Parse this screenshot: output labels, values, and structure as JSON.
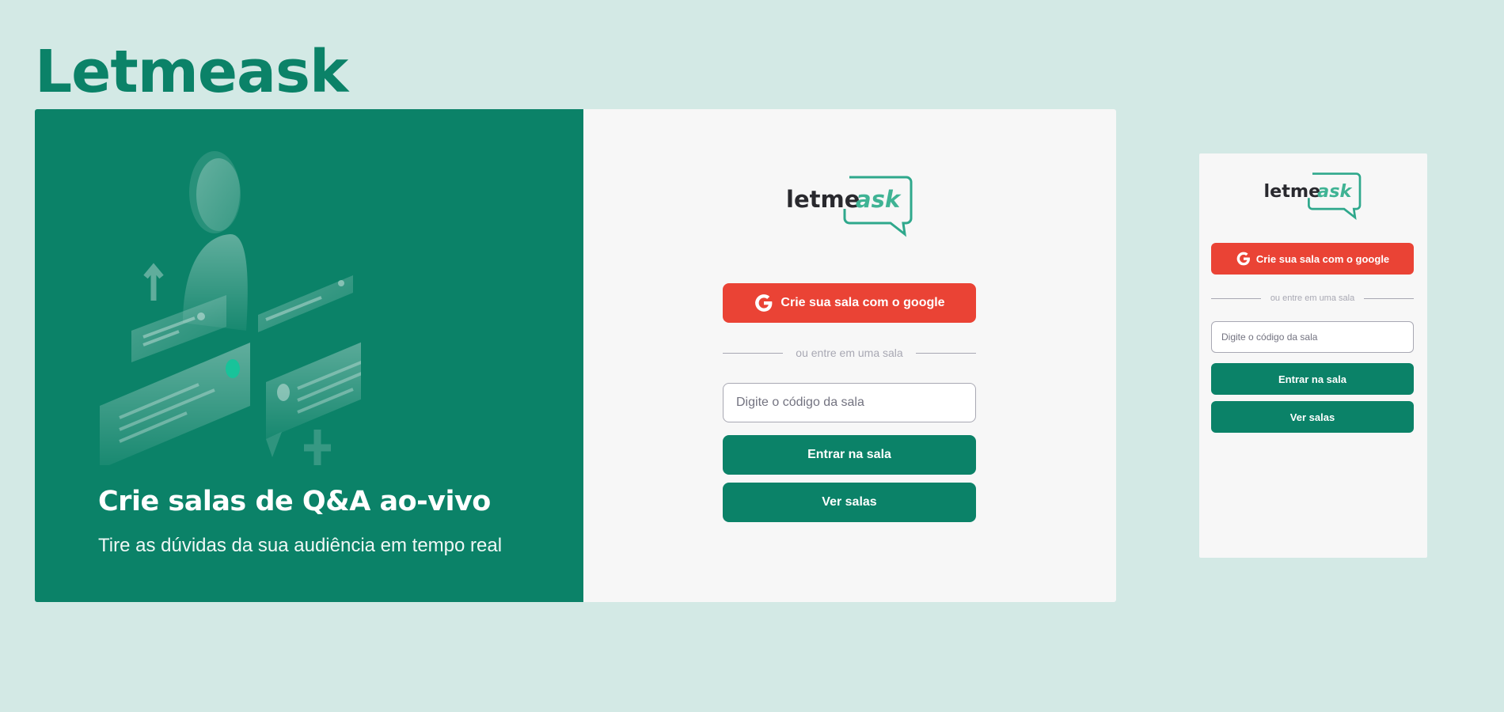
{
  "page": {
    "title": "Letmeask"
  },
  "desktop": {
    "aside": {
      "heading": "Crie salas de Q&A ao-vivo",
      "subheading": "Tire as dúvidas da sua audiência em tempo real"
    },
    "logo": {
      "word1": "letme",
      "word2": "ask"
    },
    "google_button": "Crie sua sala com o google",
    "separator": "ou entre em uma sala",
    "room_input_placeholder": "Digite o código da sala",
    "enter_button": "Entrar na sala",
    "rooms_button": "Ver salas"
  },
  "mobile": {
    "logo": {
      "word1": "letme",
      "word2": "ask"
    },
    "google_button": "Crie sua sala com o google",
    "separator": "ou entre em uma sala",
    "room_input_placeholder": "Digite o código da sala",
    "enter_button": "Entrar na sala",
    "rooms_button": "Ver salas"
  },
  "colors": {
    "background": "#d3e9e5",
    "brand_green": "#0b8268",
    "google_red": "#ea4335",
    "panel": "#f7f7f7",
    "muted": "#a8a8b3"
  },
  "icons": {
    "google": "google-g-icon",
    "illustration": "qa-illustration"
  }
}
